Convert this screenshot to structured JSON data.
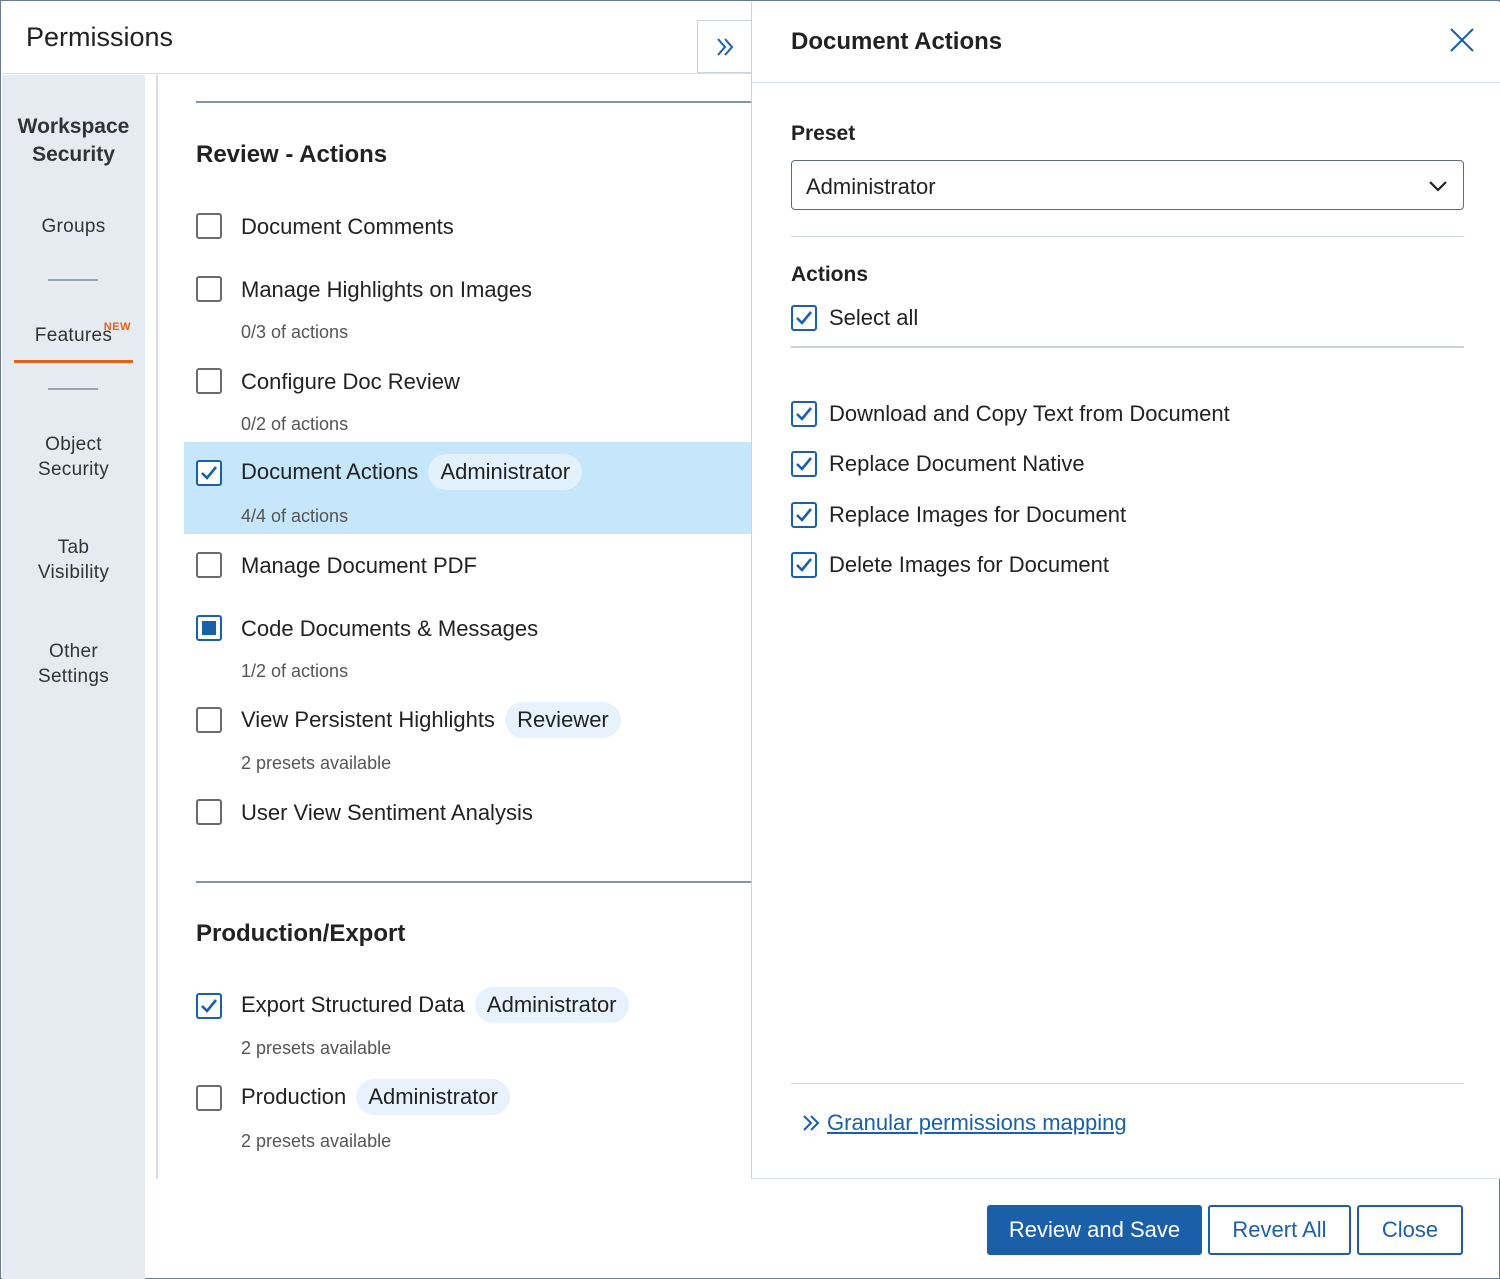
{
  "header": {
    "title": "Permissions"
  },
  "sidebar": {
    "heading_line1": "Workspace",
    "heading_line2": "Security",
    "items": [
      {
        "label": "Groups"
      },
      {
        "label": "Features",
        "badge": "NEW"
      },
      {
        "label_line1": "Object",
        "label_line2": "Security"
      },
      {
        "label_line1": "Tab",
        "label_line2": "Visibility"
      },
      {
        "label_line1": "Other",
        "label_line2": "Settings"
      }
    ],
    "accent_color": "#e3621a"
  },
  "sections": [
    {
      "title": "Review - Actions",
      "items": [
        {
          "label": "Document Comments",
          "state": "unchecked"
        },
        {
          "label": "Manage Highlights on Images",
          "state": "unchecked",
          "sub": "0/3 of actions"
        },
        {
          "label": "Configure Doc Review",
          "state": "unchecked",
          "sub": "0/2 of actions"
        },
        {
          "label": "Document Actions",
          "state": "checked",
          "preset": "Administrator",
          "sub": "4/4 of actions",
          "selected": true
        },
        {
          "label": "Manage Document PDF",
          "state": "unchecked"
        },
        {
          "label": "Code Documents & Messages",
          "state": "partial",
          "sub": "1/2 of actions"
        },
        {
          "label": "View Persistent Highlights",
          "state": "unchecked",
          "preset": "Reviewer",
          "sub": "2 presets available"
        },
        {
          "label": "User View Sentiment Analysis",
          "state": "unchecked"
        }
      ]
    },
    {
      "title": "Production/Export",
      "items": [
        {
          "label": "Export Structured Data",
          "state": "checked",
          "preset": "Administrator",
          "sub": "2 presets available"
        },
        {
          "label": "Production",
          "state": "unchecked",
          "preset": "Administrator",
          "sub": "2 presets available"
        }
      ]
    }
  ],
  "panel": {
    "title": "Document Actions",
    "preset_label": "Preset",
    "preset_value": "Administrator",
    "actions_label": "Actions",
    "select_all": "Select all",
    "actions": [
      "Download and Copy Text from Document",
      "Replace Document Native",
      "Replace Images for Document",
      "Delete Images for Document"
    ],
    "link": "Granular permissions mapping"
  },
  "footer": {
    "review_save": "Review and Save",
    "revert_all": "Revert All",
    "close": "Close"
  },
  "colors": {
    "primary": "#1a5fa8",
    "selected_row": "#c6e6fb",
    "pill": "#e8f2fc"
  }
}
